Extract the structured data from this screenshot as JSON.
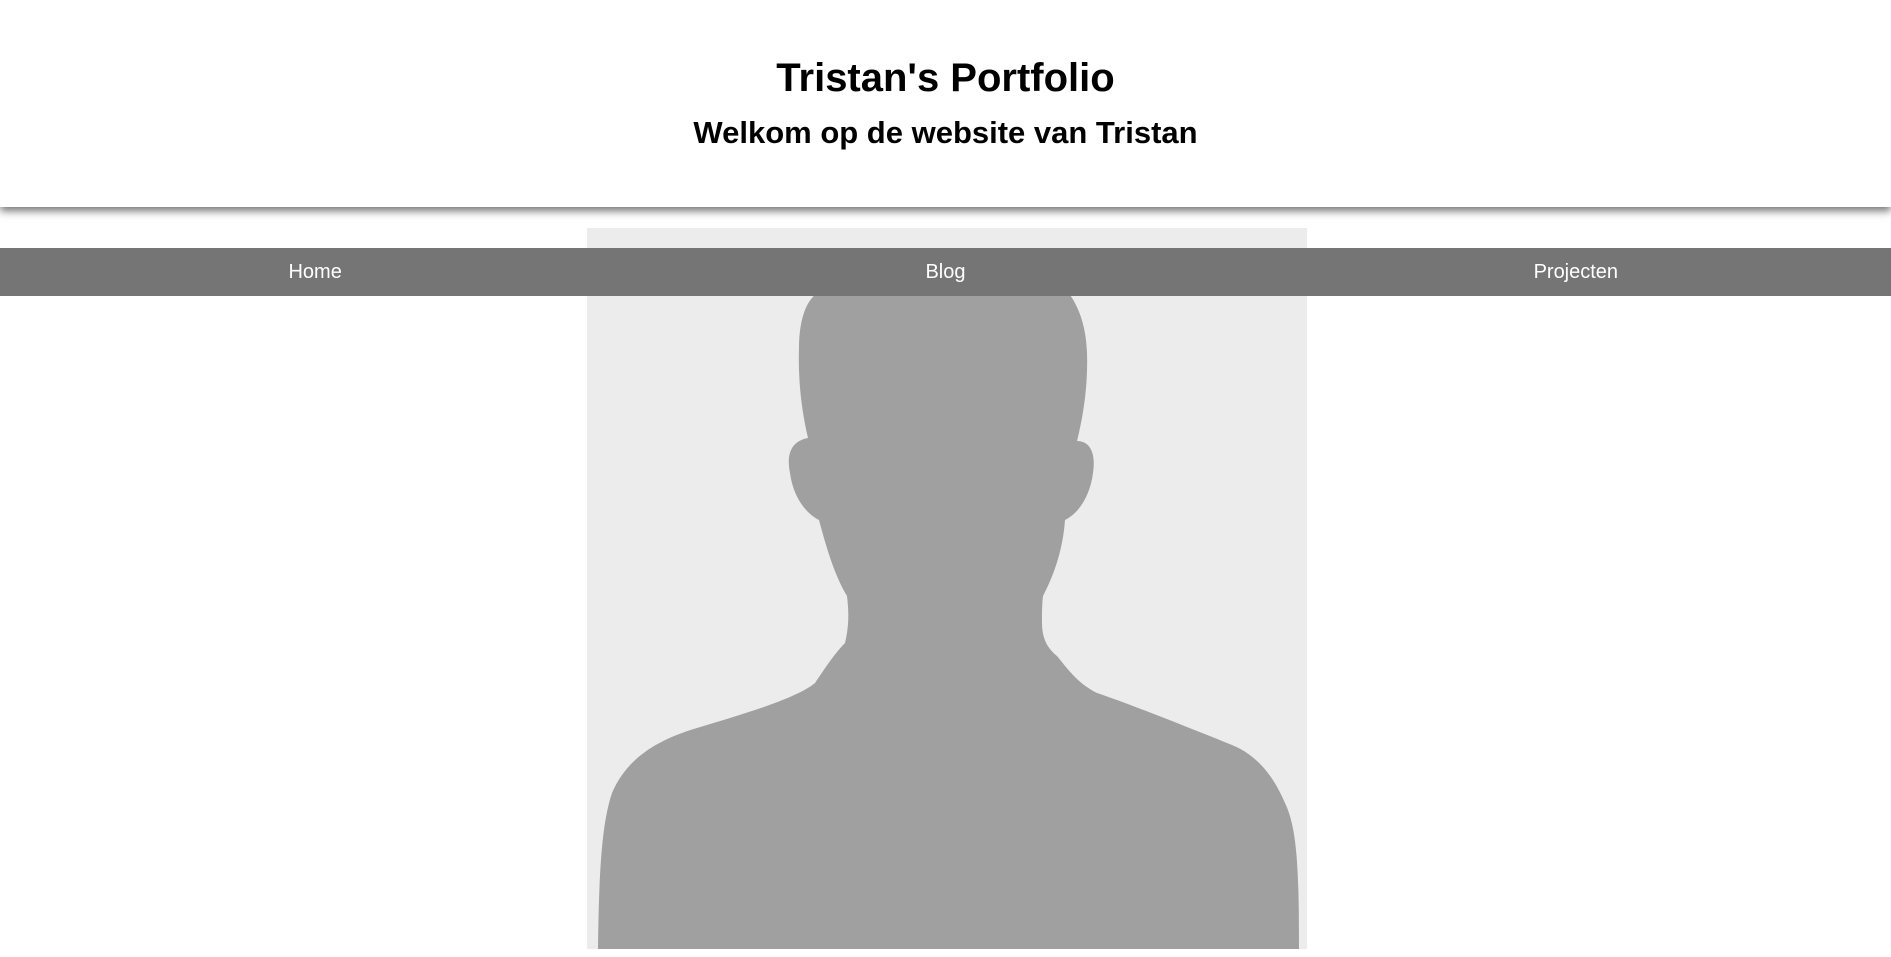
{
  "header": {
    "title": "Tristan's Portfolio",
    "subtitle": "Welkom op de website van Tristan"
  },
  "nav": {
    "items": [
      {
        "label": "Home"
      },
      {
        "label": "Blog"
      },
      {
        "label": "Projecten"
      }
    ]
  },
  "profile": {
    "image_alt": "profile-silhouette-placeholder"
  },
  "colors": {
    "nav_background": "#757575",
    "nav_text": "#ffffff",
    "photo_background": "#ececec",
    "silhouette": "#a0a0a0"
  }
}
